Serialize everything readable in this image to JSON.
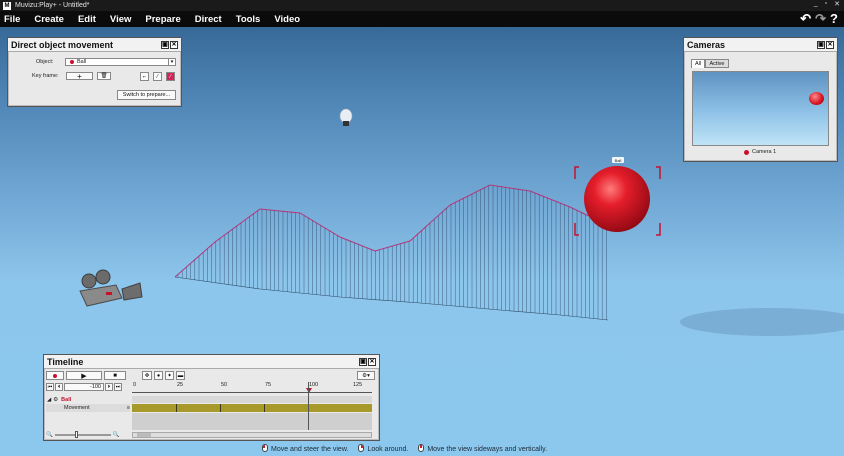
{
  "window": {
    "title": "Muvizu:Play+ - Untitled*",
    "controls": [
      "_",
      "▫",
      "✕"
    ]
  },
  "menu": {
    "items": [
      "File",
      "Create",
      "Edit",
      "View",
      "Prepare",
      "Direct",
      "Tools",
      "Video"
    ]
  },
  "dom_panel": {
    "title": "Direct object movement",
    "object_label": "Object:",
    "object_value": "Ball",
    "keyframe_label": "Key frame:",
    "add_key": "+",
    "delete_key": "🗑",
    "switch_button": "Switch to prepare..."
  },
  "cameras_panel": {
    "title": "Cameras",
    "tabs": [
      "All",
      "Active"
    ],
    "camera_name": "Camera 1"
  },
  "scene": {
    "ball_tag": "Ball"
  },
  "timeline": {
    "title": "Timeline",
    "frame_value": "-100",
    "ruler_labels": [
      "0",
      "25",
      "50",
      "75",
      "100",
      "125"
    ],
    "track_object": "Ball",
    "track_property": "Movement"
  },
  "status": {
    "hint1": "Move and steer the view.",
    "hint2": "Look around.",
    "hint3": "Move the view sideways and vertically."
  },
  "colors": {
    "accent": "#c8102e",
    "ball": "#e01a2a",
    "track": "#a79a2b"
  }
}
